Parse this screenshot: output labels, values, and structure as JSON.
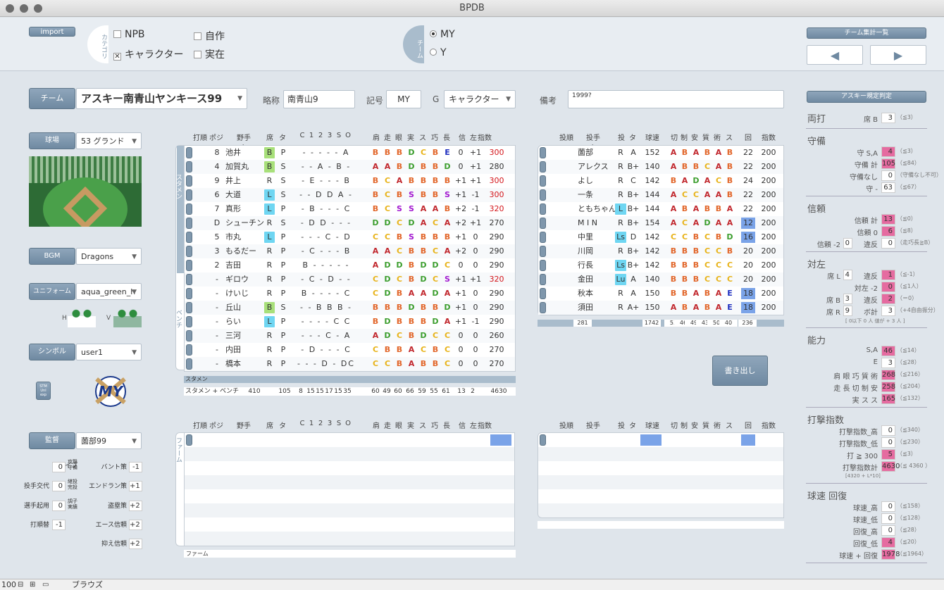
{
  "window": {
    "title": "BPDB"
  },
  "top": {
    "import": "import",
    "category_label": "カテゴリ",
    "cat": [
      {
        "label": "NPB",
        "checked": false
      },
      {
        "label": "自作",
        "checked": false
      },
      {
        "label": "キャラクター",
        "checked": true
      },
      {
        "label": "実在",
        "checked": false
      }
    ],
    "team_label": "チーム",
    "teams": [
      {
        "label": "MY",
        "selected": true
      },
      {
        "label": "Y",
        "selected": false
      }
    ],
    "team_summary": "チーム集計一覧"
  },
  "fields": {
    "team_btn": "チーム",
    "team_name": "アスキー南青山ヤンキース99",
    "abbr_label": "略称",
    "abbr": "南青山9",
    "sym_label": "記号",
    "sym": "MY",
    "g_label": "G",
    "g": "キャラクター",
    "note_label": "備考",
    "note": "1999?",
    "stadium_btn": "球場",
    "stadium": "53 グランド",
    "bgm_btn": "BGM",
    "bgm": "Dragons",
    "uniform_btn": "ユニフォーム",
    "uniform": "aqua_green_h",
    "h": "H",
    "v": "V",
    "symbol_btn": "シンボル",
    "symbol": "user1",
    "stm": "STM\nUnl\nexp",
    "manager_btn": "監督",
    "manager": "薗部99",
    "logo": "MY"
  },
  "manager_settings": [
    {
      "label": "タイプ",
      "v": "0",
      "sub": "攻撃\n守備"
    },
    {
      "label": "投手交代",
      "v": "0",
      "sub": "継投\n完投"
    },
    {
      "label": "選手起用",
      "v": "0",
      "sub": "調子\n実績"
    },
    {
      "label": "打順替",
      "v": "-1",
      "sub": ""
    }
  ],
  "manager_settings2": [
    {
      "label": "バント策",
      "v": "-1"
    },
    {
      "label": "エンドラン策",
      "v": "+1"
    },
    {
      "label": "盗塁策",
      "v": "+2"
    },
    {
      "label": "エース信頼",
      "v": "+2"
    },
    {
      "label": "抑え信頼",
      "v": "+2"
    }
  ],
  "bat_headers": [
    "打順",
    "ポジ",
    "野手名",
    "席",
    "タ",
    "C",
    "1",
    "2",
    "3",
    "S",
    "O",
    "肩",
    "走",
    "眼",
    "実",
    "ス",
    "巧",
    "長",
    "信",
    "左",
    "指数"
  ],
  "batters": [
    {
      "o": "8",
      "p": "池井",
      "b": "B",
      "hl": "b",
      "t": "P",
      "pos": "- - - - - A",
      "g": "BBBDCBE",
      "s": "0",
      "l": "+1",
      "i": "300",
      "ir": true
    },
    {
      "o": "4",
      "p": "加賀丸",
      "b": "B",
      "hl": "b",
      "t": "S",
      "pos": "- - A - B -",
      "g": "AABDBBD",
      "s": "0",
      "l": "+1",
      "i": "280",
      "ir": false
    },
    {
      "o": "9",
      "p": "井上",
      "b": "R",
      "hl": "",
      "t": "S",
      "pos": "- E - - - B",
      "g": "BCABBBB",
      "s": "+1",
      "l": "+1",
      "i": "300",
      "ir": true
    },
    {
      "o": "6",
      "p": "大道",
      "b": "L",
      "hl": "l",
      "t": "S",
      "pos": "- - D D A -",
      "g": "BCBSBBS",
      "s": "+1",
      "l": "-1",
      "i": "300",
      "ir": true
    },
    {
      "o": "7",
      "p": "真形",
      "b": "L",
      "hl": "l",
      "t": "P",
      "pos": "- B - - - C",
      "g": "BCSSAAB",
      "s": "+2",
      "l": "-1",
      "i": "320",
      "ir": true
    },
    {
      "o": "D",
      "p": "シューチン",
      "b": "R",
      "hl": "",
      "t": "S",
      "pos": "- D D - - -",
      "g": "DDCDACA",
      "s": "+2",
      "l": "+1",
      "i": "270",
      "ir": false
    },
    {
      "o": "5",
      "p": "市丸",
      "b": "L",
      "hl": "l",
      "t": "P",
      "pos": "- - - C - D",
      "g": "CCBSBBB",
      "s": "+1",
      "l": "0",
      "i": "290",
      "ir": false
    },
    {
      "o": "3",
      "p": "もるだー",
      "b": "R",
      "hl": "",
      "t": "P",
      "pos": "- C - - - B",
      "g": "AACBBCA",
      "s": "+2",
      "l": "0",
      "i": "290",
      "ir": false
    },
    {
      "o": "2",
      "p": "吉田",
      "b": "R",
      "hl": "",
      "t": "P",
      "pos": "B - - - - -",
      "g": "ADDBDDC",
      "s": "0",
      "l": "0",
      "i": "290",
      "ir": false
    },
    {
      "o": "-",
      "p": "ギロウ",
      "b": "R",
      "hl": "",
      "t": "P",
      "pos": "- C - D - -",
      "g": "CDCBDCS",
      "s": "+1",
      "l": "+1",
      "i": "320",
      "ir": true
    },
    {
      "o": "-",
      "p": "けいじ",
      "b": "R",
      "hl": "",
      "t": "P",
      "pos": "B - - - - C",
      "g": "CDBAADA",
      "s": "+1",
      "l": "0",
      "i": "290",
      "ir": false
    },
    {
      "o": "-",
      "p": "丘山",
      "b": "B",
      "hl": "b",
      "t": "S",
      "pos": "- - B B B -",
      "g": "BBBDBBD",
      "s": "+1",
      "l": "0",
      "i": "290",
      "ir": false
    },
    {
      "o": "-",
      "p": "らい",
      "b": "L",
      "hl": "l",
      "t": "P",
      "pos": "- - - - C C",
      "g": "BDBBBDA",
      "s": "+1",
      "l": "-1",
      "i": "290",
      "ir": false
    },
    {
      "o": "-",
      "p": "三河",
      "b": "R",
      "hl": "",
      "t": "P",
      "pos": "- - - C - A",
      "g": "ADCBDCC",
      "s": "0",
      "l": "0",
      "i": "260",
      "ir": false
    },
    {
      "o": "-",
      "p": "内田",
      "b": "R",
      "hl": "",
      "t": "P",
      "pos": "- D - - - C",
      "g": "CBBACBC",
      "s": "0",
      "l": "0",
      "i": "270",
      "ir": false
    },
    {
      "o": "-",
      "p": "橋本",
      "b": "R",
      "hl": "",
      "t": "P",
      "pos": "- - - D - DC",
      "g": "CCBABBC",
      "s": "0",
      "l": "0",
      "i": "270",
      "ir": false
    }
  ],
  "bat_side": {
    "starters": "スタメン",
    "bench": "ベンチ",
    "farm": "ファーム"
  },
  "bat_summary": {
    "label1": "スタメン",
    "label2": "スタメン + ベンチ",
    "v": [
      "410",
      "105",
      "8",
      "15",
      "15",
      "17",
      "15",
      "35",
      "60",
      "49",
      "60",
      "66",
      "59",
      "55",
      "61",
      "13",
      "2",
      "4630"
    ]
  },
  "pit_headers": [
    "投順",
    "投手名",
    "投",
    "タ",
    "球速",
    "切",
    "制",
    "安",
    "質",
    "術",
    "ス",
    "回",
    "指数"
  ],
  "pitchers": [
    {
      "n": "薗部",
      "h": "R",
      "hl": "",
      "t": "A",
      "sp": "152",
      "g": "ABABAB",
      "k": "22",
      "ks": false,
      "i": "200"
    },
    {
      "n": "アレクス",
      "h": "R",
      "hl": "",
      "t": "B+",
      "sp": "140",
      "g": "ABBCAB",
      "k": "22",
      "ks": false,
      "i": "200"
    },
    {
      "n": "よし",
      "h": "R",
      "hl": "",
      "t": "C",
      "sp": "142",
      "g": "BADACB",
      "k": "24",
      "ks": false,
      "i": "200"
    },
    {
      "n": "一条",
      "h": "R",
      "hl": "",
      "t": "B+",
      "sp": "144",
      "g": "ACCAAB",
      "k": "22",
      "ks": false,
      "i": "200"
    },
    {
      "n": "ともちゃん",
      "h": "L",
      "hl": "l",
      "t": "B+",
      "sp": "144",
      "g": "ABABBA",
      "k": "22",
      "ks": false,
      "i": "200"
    },
    {
      "n": "M I N",
      "h": "R",
      "hl": "",
      "t": "B+",
      "sp": "154",
      "g": "ACADAA",
      "k": "12",
      "ks": true,
      "i": "200"
    },
    {
      "n": "中里",
      "h": "Ls",
      "hl": "l",
      "t": "D",
      "sp": "142",
      "g": "CCBCBD",
      "k": "16",
      "ks": true,
      "i": "200"
    },
    {
      "n": "川岡",
      "h": "R",
      "hl": "",
      "t": "B+",
      "sp": "142",
      "g": "BBBCCB",
      "k": "20",
      "ks": false,
      "i": "200"
    },
    {
      "n": "行長",
      "h": "Ls",
      "hl": "l",
      "t": "B+",
      "sp": "142",
      "g": "BBBCCC",
      "k": "20",
      "ks": false,
      "i": "200"
    },
    {
      "n": "金田",
      "h": "Lu",
      "hl": "l",
      "t": "A",
      "sp": "140",
      "g": "BBBCCC",
      "k": "20",
      "ks": false,
      "i": "200"
    },
    {
      "n": "秋本",
      "h": "R",
      "hl": "",
      "t": "A",
      "sp": "150",
      "g": "BBABAE",
      "k": "18",
      "ks": true,
      "i": "200"
    },
    {
      "n": "須田",
      "h": "R",
      "hl": "",
      "t": "A+",
      "sp": "150",
      "g": "ABABAE",
      "k": "18",
      "ks": true,
      "i": "200"
    }
  ],
  "pit_summary": [
    "281",
    "1742",
    "53",
    "46",
    "49",
    "43",
    "50",
    "40",
    "236"
  ],
  "export": "書き出し",
  "right": {
    "btn": "アスキー規定判定",
    "sections": [
      {
        "title": "両打",
        "rows": [
          {
            "l": "席 B",
            "v": "3",
            "pink": false,
            "n": "（≦3）"
          }
        ]
      },
      {
        "title": "守備",
        "rows": [
          {
            "l": "守 S,A",
            "v": "4",
            "pink": true,
            "n": "（≦3）"
          },
          {
            "l": "守備 計",
            "v": "105",
            "pink": true,
            "n": "（≦84）"
          },
          {
            "l": "守備なし",
            "v": "0",
            "pink": false,
            "n": "（守備なし不可）"
          },
          {
            "l": "守 -",
            "v": "63",
            "pink": false,
            "n": "（≦67）"
          }
        ]
      },
      {
        "title": "信頼",
        "rows": [
          {
            "l": "信頼 計",
            "v": "13",
            "pink": true,
            "n": "（≦0）"
          },
          {
            "l": "信頼 0",
            "v": "6",
            "pink": true,
            "n": "（≦8）"
          },
          {
            "l": "信頼 -2",
            "v": "0",
            "pink": false,
            "n": "（走巧長≧B）",
            "pre": "違反",
            "pv": "0"
          }
        ]
      },
      {
        "title": "対左",
        "rows": [
          {
            "l": "席 L",
            "v": "1",
            "pink": true,
            "n": "（≦-1）",
            "pre": "違反",
            "pv": "4"
          },
          {
            "l": "対左 -2",
            "v": "0",
            "pink": true,
            "n": "（≦1人）"
          },
          {
            "l": "席 B",
            "v": "2",
            "pink": true,
            "n": "（＝0）",
            "pre": "違反",
            "pv": "3"
          },
          {
            "l": "席 R",
            "v": "3",
            "pink": false,
            "n": "（+4自由振分）",
            "pre": "ボ計",
            "pv": "9"
          }
        ],
        "note": "[ 0以下  0 人  値が + 3 人 ]"
      },
      {
        "title": "能力",
        "rows": [
          {
            "l": "S,A",
            "v": "46",
            "pink": true,
            "n": "（≦14）"
          },
          {
            "l": "E",
            "v": "3",
            "pink": false,
            "n": "（≦28）"
          },
          {
            "l": "肩 眼 巧 質 術",
            "v": "268",
            "pink": true,
            "n": "（≦216）"
          },
          {
            "l": "走 長 切 制 安",
            "v": "258",
            "pink": true,
            "n": "（≦204）"
          },
          {
            "l": "実 ス ス",
            "v": "165",
            "pink": true,
            "n": "（≦132）"
          }
        ]
      },
      {
        "title": "打撃指数",
        "rows": [
          {
            "l": "打撃指数_高",
            "v": "0",
            "pink": false,
            "n": "（≦340）"
          },
          {
            "l": "打撃指数_低",
            "v": "0",
            "pink": false,
            "n": "（≦230）"
          },
          {
            "l": "打 ≧ 300",
            "v": "5",
            "pink": true,
            "n": "（≦3）"
          },
          {
            "l": "打撃指数計",
            "v": "4630",
            "pink": true,
            "n": "（≦ 4360 ）"
          }
        ],
        "note": "[4320 + L*10]"
      },
      {
        "title": "球速  回復",
        "rows": [
          {
            "l": "球速_高",
            "v": "0",
            "pink": false,
            "n": "（≦158）"
          },
          {
            "l": "球速_低",
            "v": "0",
            "pink": false,
            "n": "（≦128）"
          },
          {
            "l": "回復_高",
            "v": "0",
            "pink": false,
            "n": "（≦28）"
          },
          {
            "l": "回復_低",
            "v": "4",
            "pink": true,
            "n": "（≦20）"
          },
          {
            "l": "球速 + 回復",
            "v": "1978",
            "pink": true,
            "n": "（≦1964）"
          }
        ]
      }
    ]
  },
  "status": {
    "zoom": "100",
    "mode": "ブラウズ"
  },
  "colors": {
    "accent": "#7f97ac",
    "pink": "#e56ba0",
    "grA": "#c1272d",
    "grB": "#e2662a",
    "grC": "#e8b319",
    "grD": "#3c9e2e",
    "grE": "#1f2fbf",
    "grS": "#a31ad0"
  }
}
